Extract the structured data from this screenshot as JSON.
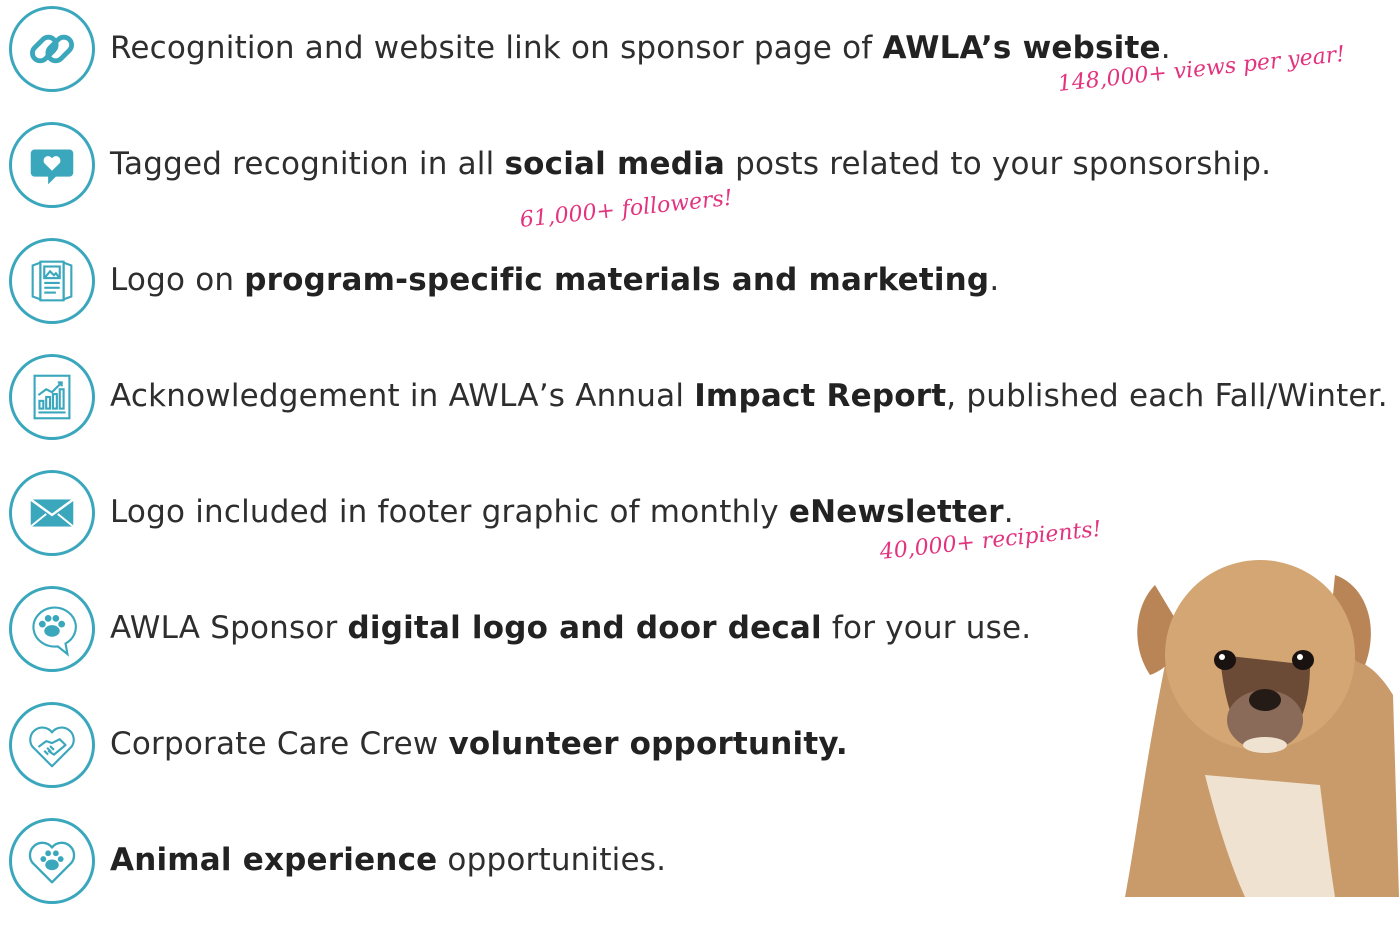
{
  "benefits": [
    {
      "icon": "link-icon",
      "pre": "Recognition and website link on sponsor page of ",
      "bold": "AWLA’s website",
      "post": ".",
      "note": "148,000+ views per year!"
    },
    {
      "icon": "heart-chat-icon",
      "pre": "Tagged recognition in all ",
      "bold": "social media",
      "post": " posts related to your sponsorship.",
      "note": "61,000+ followers!"
    },
    {
      "icon": "brochure-icon",
      "pre": "Logo on ",
      "bold": "program-specific materials and marketing",
      "post": ".",
      "note": ""
    },
    {
      "icon": "report-chart-icon",
      "pre": "Acknowledgement in AWLA’s Annual ",
      "bold": "Impact Report",
      "post": ", published each Fall/Winter.",
      "note": ""
    },
    {
      "icon": "envelope-icon",
      "pre": "Logo included in footer graphic of monthly ",
      "bold": "eNewsletter",
      "post": ".",
      "note": "40,000+ recipients!"
    },
    {
      "icon": "paw-speech-icon",
      "pre": "AWLA Sponsor ",
      "bold": "digital logo and door decal",
      "post": " for your use.",
      "note": ""
    },
    {
      "icon": "handshake-heart-icon",
      "pre": "Corporate Care Crew ",
      "bold": "volunteer opportunity.",
      "post": "",
      "note": ""
    },
    {
      "icon": "paw-heart-icon",
      "pre": "",
      "bold": "Animal experience",
      "post": " opportunities.",
      "note": ""
    }
  ],
  "colors": {
    "icon": "#3ba7bd",
    "note": "#e2337f",
    "text": "#2e2e2e"
  },
  "image": "puppy-photo"
}
